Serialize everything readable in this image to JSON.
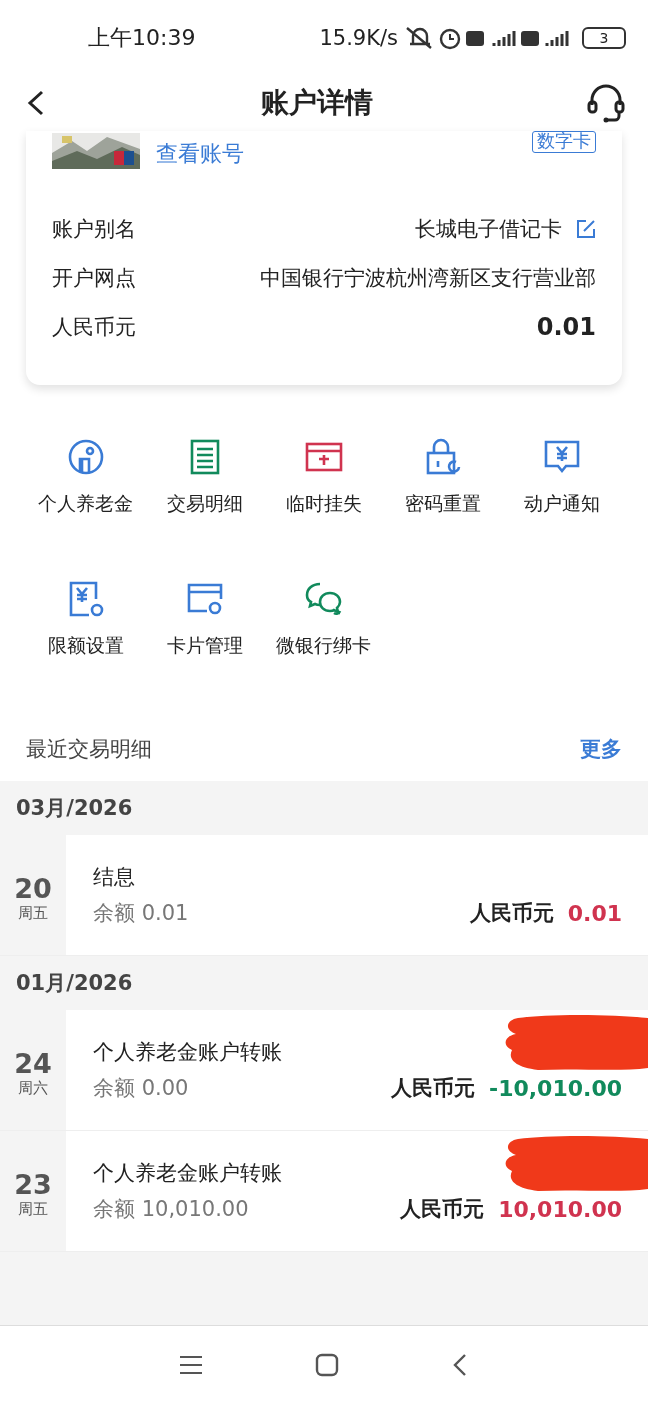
{
  "status_bar": {
    "time": "上午10:39",
    "speed": "15.9K/s",
    "battery": "3"
  },
  "header": {
    "title": "账户详情"
  },
  "card": {
    "view_link": "查看账号",
    "badge": "数字卡",
    "rows": [
      {
        "kind": "editable",
        "label": "账户别名",
        "value": "长城电子借记卡"
      },
      {
        "kind": "plain",
        "label": "开户网点",
        "value": "中国银行宁波杭州湾新区支行营业部"
      },
      {
        "kind": "amount",
        "label": "人民币元",
        "value": "0.01"
      }
    ]
  },
  "services": [
    {
      "kind": "pension",
      "label": "个人养老金"
    },
    {
      "kind": "list",
      "label": "交易明细"
    },
    {
      "kind": "loss",
      "label": "临时挂失"
    },
    {
      "kind": "lock",
      "label": "密码重置"
    },
    {
      "kind": "notice",
      "label": "动户通知"
    },
    {
      "kind": "limit",
      "label": "限额设置"
    },
    {
      "kind": "card",
      "label": "卡片管理"
    },
    {
      "kind": "wechat",
      "label": "微银行绑卡"
    }
  ],
  "recent": {
    "title": "最近交易明细",
    "more": "更多",
    "months": [
      {
        "month": "03月/2026",
        "transactions": [
          {
            "day": "20",
            "weekday": "周五",
            "title": "结息",
            "balance_label": "余额",
            "balance": "0.01",
            "currency": "人民币元",
            "amount": "0.01",
            "kind": "credit",
            "redacted": false
          }
        ]
      },
      {
        "month": "01月/2026",
        "transactions": [
          {
            "day": "24",
            "weekday": "周六",
            "title": "个人养老金账户转账",
            "balance_label": "余额",
            "balance": "0.00",
            "currency": "人民币元",
            "amount": "-10,010.00",
            "kind": "debit",
            "redacted": true
          },
          {
            "day": "23",
            "weekday": "周五",
            "title": "个人养老金账户转账",
            "balance_label": "余额",
            "balance": "10,010.00",
            "currency": "人民币元",
            "amount": "10,010.00",
            "kind": "credit",
            "redacted": true
          }
        ]
      }
    ]
  }
}
